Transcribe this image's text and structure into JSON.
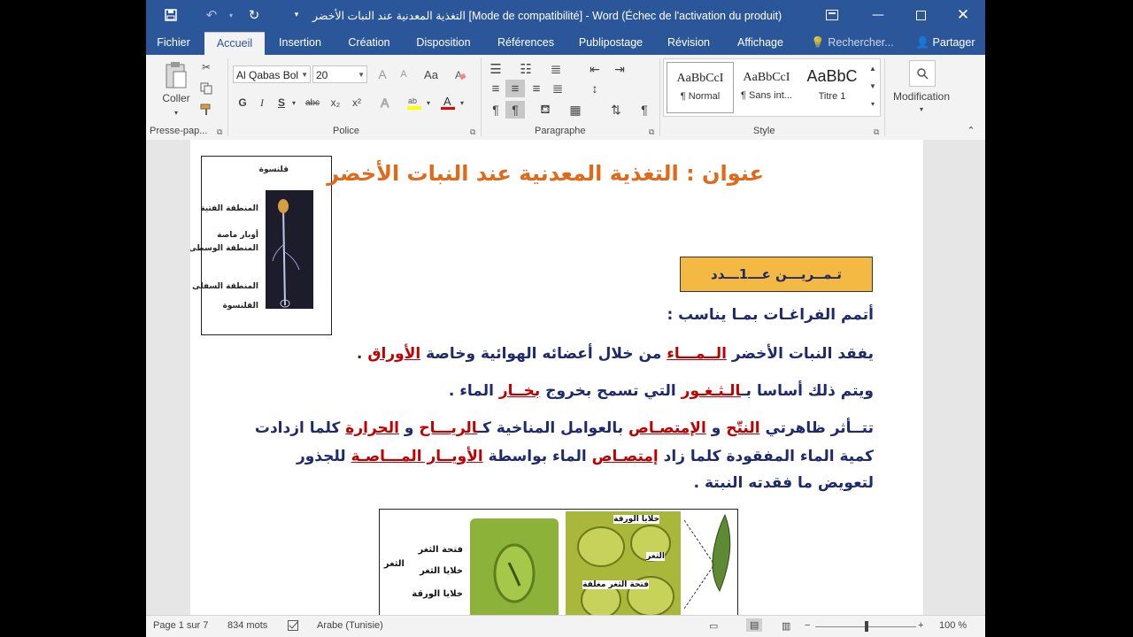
{
  "window": {
    "title": "التغذية المعدنية عند النبات الأخضر [Mode de compatibilité] - Word (Échec de l'activation du produit)"
  },
  "tabs": [
    {
      "label": "Fichier"
    },
    {
      "label": "Accueil"
    },
    {
      "label": "Insertion"
    },
    {
      "label": "Création"
    },
    {
      "label": "Disposition"
    },
    {
      "label": "Références"
    },
    {
      "label": "Publipostage"
    },
    {
      "label": "Révision"
    },
    {
      "label": "Affichage"
    },
    {
      "label": "Rechercher..."
    },
    {
      "label": "Partager"
    }
  ],
  "ribbon": {
    "clipboard": {
      "paste_label": "Coller",
      "group_label": "Presse-pap..."
    },
    "font": {
      "font_name": "Al Qabas Bol",
      "font_size": "20",
      "bold": "G",
      "italic": "I",
      "underline": "S",
      "strike": "abc",
      "subscript": "x₂",
      "superscript": "x²",
      "grow": "A",
      "shrink": "A",
      "case": "Aa",
      "group_label": "Police"
    },
    "paragraph": {
      "group_label": "Paragraphe"
    },
    "styles": {
      "items": [
        {
          "preview": "AaBbCcI",
          "name": "¶ Normal"
        },
        {
          "preview": "AaBbCcI",
          "name": "¶ Sans int..."
        },
        {
          "preview": "AaBbC",
          "name": "Titre 1"
        }
      ],
      "group_label": "Style"
    },
    "editing": {
      "label": "Modification"
    }
  },
  "document": {
    "title": "عنوان : التغذية المعدنية عند النبات الأخضر",
    "exercise_label": "تـمــريـــن عـــ1ـــدد",
    "instruction": "أتمم الفراغـات بمـا يناسب :",
    "line1": {
      "a": "يفقد النبات الأخضر ",
      "b": "الــمـــاء",
      "c": " من خلال أعضائه الهوائية وخاصة ",
      "d": "الأوراق",
      "e": " ."
    },
    "line2": {
      "a": "ويتم ذلك أساسا بـ",
      "b": "الـثـغـور",
      "c": " التي تسمح بخروج ",
      "d": "بخــار",
      "e": " الماء ."
    },
    "line3": {
      "a": "تتــأثر ظاهرتي ",
      "b": "النتّح",
      "c": " و ",
      "d": "الإمتصـاص",
      "e": " بالعوامل المناخية كـ",
      "f": "الريـــاح",
      "g": " و ",
      "h": "الحرارة",
      "i": " كلما ازدادت"
    },
    "line4": {
      "a": "كمية الماء المفقودة كلما زاد ",
      "b": "إمتصـاص",
      "c": " الماء بواسطة ",
      "d": "الأويــار المـــاصـة",
      "e": " للجذور"
    },
    "line5": "لتعويض ما فقدته النبتة .",
    "plant_labels": [
      "قلنسوة",
      "المنطقة الفتية",
      "أوبار ماصة",
      "المنطقة الوسطى",
      "المنطقة السفلى",
      "القلنسوة"
    ],
    "stoma_labels": [
      "فتحة الثغر",
      "خلايا الثغر",
      "خلايا الورقة",
      "الثغر"
    ],
    "leaf_labels": [
      "خلايا الورقة",
      "الثغر",
      "فتحة الثغر مغلقة"
    ]
  },
  "status": {
    "page": "Page 1 sur 7",
    "words": "834 mots",
    "language": "Arabe (Tunisie)",
    "zoom": "100 %"
  },
  "colors": {
    "title_bar": "#2b579a",
    "heading_orange": "#e0691a",
    "body_text": "#1f2a6b",
    "answer_red": "#c00000",
    "exercise_box": "#f4b942"
  }
}
